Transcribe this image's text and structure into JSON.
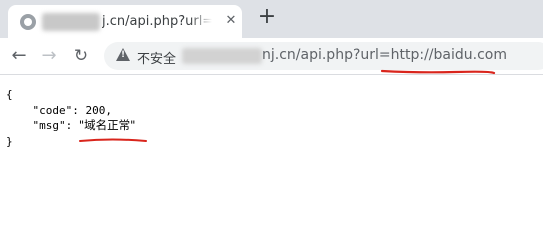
{
  "browser": {
    "tab": {
      "title": "j.cn/api.php?url=http",
      "close_label": "✕"
    },
    "new_tab_label": "+",
    "nav": {
      "back": "←",
      "forward": "→",
      "reload": "↻"
    },
    "omnibox": {
      "security_label": "不安全",
      "url_visible": "nj.cn/api.php?url=http://baidu.com"
    }
  },
  "response": {
    "open_brace": "{",
    "code_line": "    \"code\": 200,",
    "msg_key": "    \"msg\": ",
    "msg_value": "\"域名正常\"",
    "close_brace": "}"
  },
  "colors": {
    "annotation": "#d9251c"
  }
}
